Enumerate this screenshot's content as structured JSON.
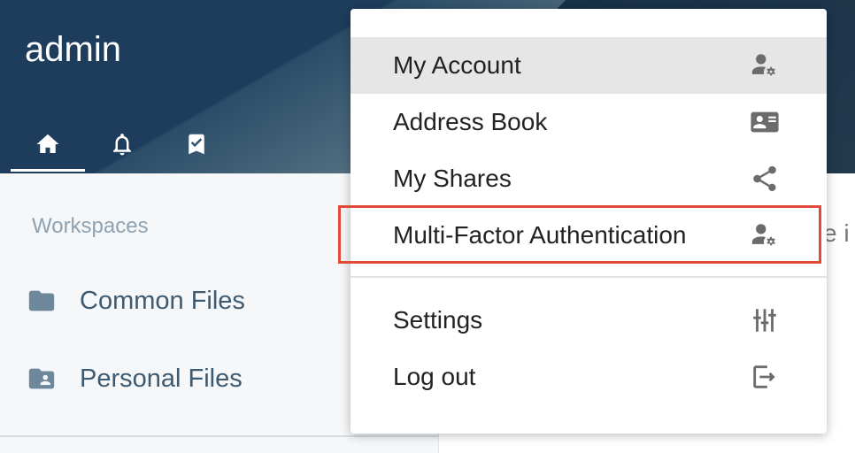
{
  "header": {
    "username": "admin",
    "tabs": [
      {
        "name": "home",
        "icon": "home-icon",
        "active": true
      },
      {
        "name": "notifications",
        "icon": "bell-icon",
        "active": false
      },
      {
        "name": "bookmarks",
        "icon": "bookmark-check-icon",
        "active": false
      }
    ]
  },
  "sidebar": {
    "section_title": "Workspaces",
    "items": [
      {
        "label": "Common Files",
        "icon": "folder-icon"
      },
      {
        "label": "Personal Files",
        "icon": "person-folder-icon"
      }
    ]
  },
  "right_panel": {
    "peek_text": "e i"
  },
  "user_menu": {
    "items": [
      {
        "label": "My Account",
        "icon": "user-settings-icon",
        "highlighted": true
      },
      {
        "label": "Address Book",
        "icon": "contact-card-icon",
        "highlighted": false
      },
      {
        "label": "My Shares",
        "icon": "share-icon",
        "highlighted": false
      },
      {
        "label": "Multi-Factor Authentication",
        "icon": "user-settings-icon",
        "highlighted": false
      },
      {
        "label": "Settings",
        "icon": "sliders-icon",
        "highlighted": false
      },
      {
        "label": "Log out",
        "icon": "logout-icon",
        "highlighted": false
      }
    ]
  },
  "annotation": {
    "highlight_color": "#e04a36",
    "target": "Multi-Factor Authentication"
  },
  "colors": {
    "header_dark": "#1e3d5c",
    "sidebar_bg": "#f5f7f9",
    "sidebar_text": "#3e5a70",
    "section_title": "#8ea3b2",
    "menu_hover": "#e6e6e6"
  }
}
